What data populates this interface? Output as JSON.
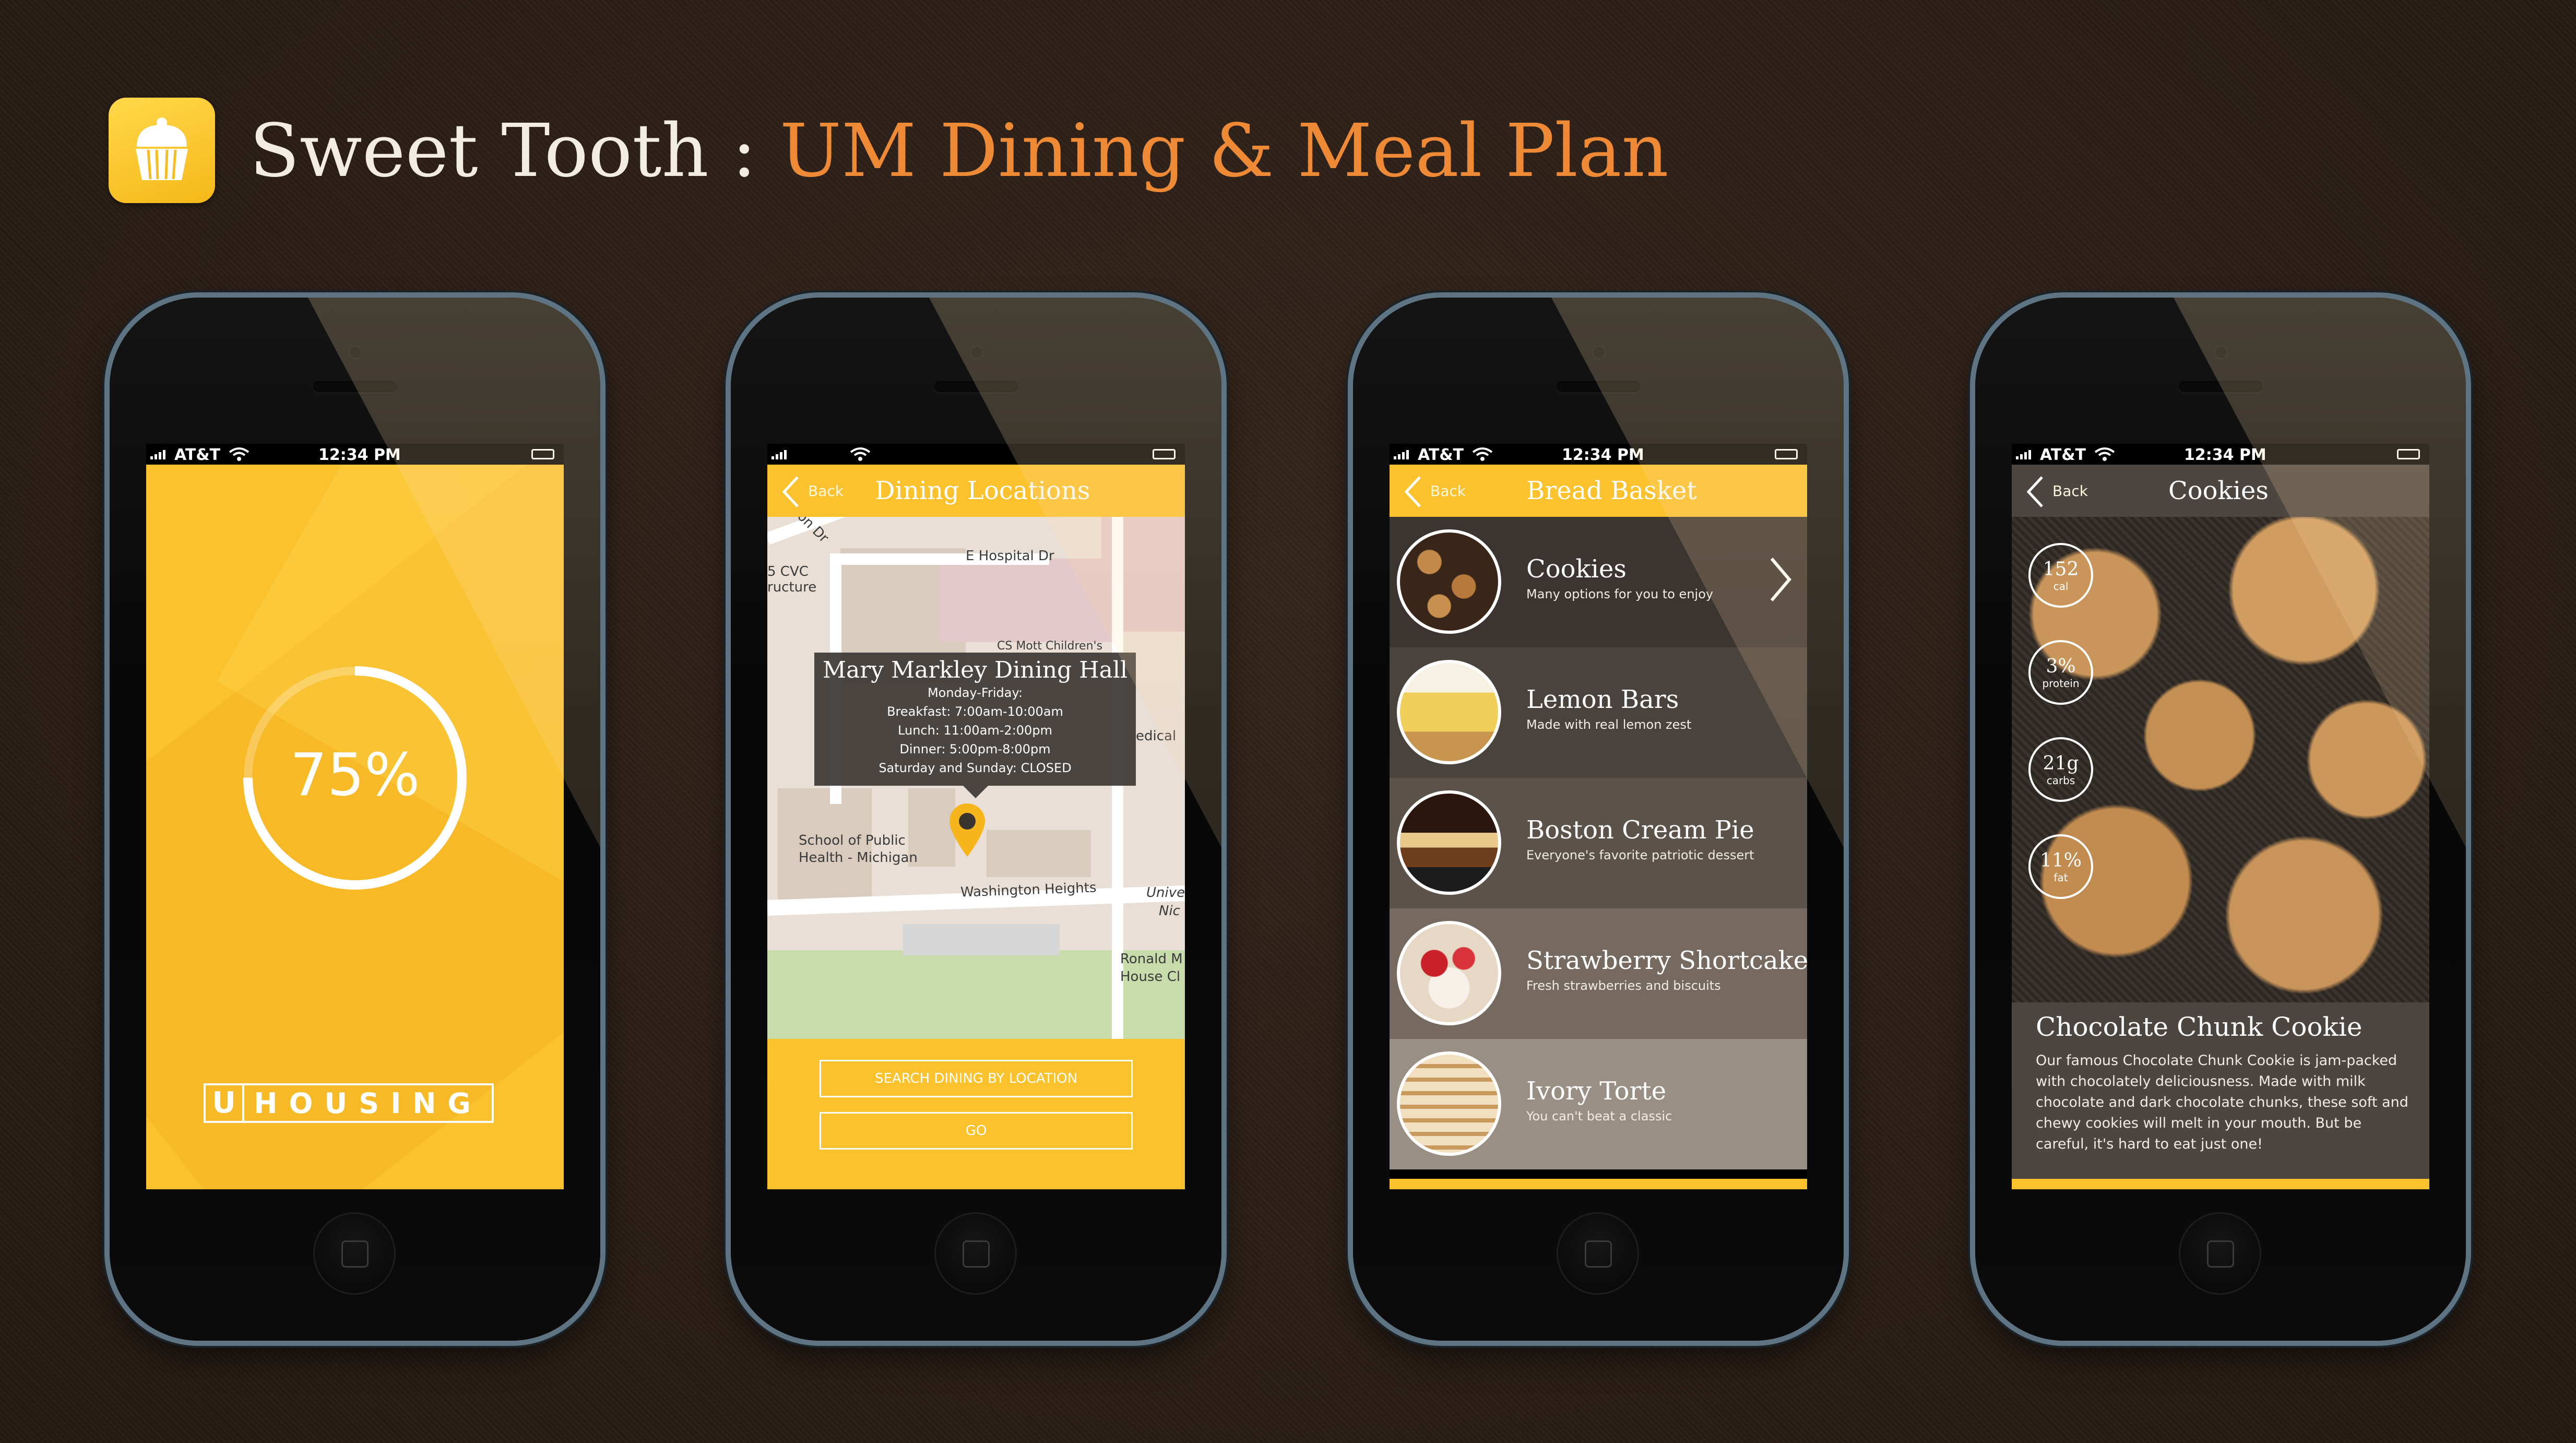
{
  "header": {
    "title_part1": "Sweet Tooth : ",
    "title_part2": "UM Dining & Meal Plan",
    "icon": "cupcake-icon",
    "accent_color": "#ee8a36"
  },
  "status": {
    "carrier": "AT&T",
    "time": "12:34 PM"
  },
  "screen1": {
    "progress_label": "75%",
    "progress_value": 0.75,
    "brand_letter": "U",
    "brand_word": "HOUSING"
  },
  "screen2": {
    "back_label": "Back",
    "title": "Dining Locations",
    "map_labels": [
      "E Hospital Dr",
      "5 CVC",
      "ructure",
      "CS Mott Children's",
      "edical",
      "School of Public",
      "Health - Michigan",
      "Washington Heights",
      "Unive",
      "Nic",
      "Ronald M",
      "House Cl",
      "son Dr"
    ],
    "popup": {
      "title": "Mary Markley Dining Hall",
      "lines": [
        "Monday-Friday:",
        "Breakfast: 7:00am-10:00am",
        "Lunch: 11:00am-2:00pm",
        "Dinner: 5:00pm-8:00pm",
        "Saturday and Sunday: CLOSED"
      ]
    },
    "search_placeholder": "SEARCH DINING BY LOCATION",
    "go_label": "GO"
  },
  "screen3": {
    "back_label": "Back",
    "title": "Bread Basket",
    "items": [
      {
        "name": "Cookies",
        "desc": "Many options for you to enjoy"
      },
      {
        "name": "Lemon Bars",
        "desc": "Made with real lemon zest"
      },
      {
        "name": "Boston Cream Pie",
        "desc": "Everyone's favorite patriotic dessert"
      },
      {
        "name": "Strawberry Shortcake",
        "desc": "Fresh strawberries and biscuits"
      },
      {
        "name": "Ivory Torte",
        "desc": "You can't beat a classic"
      }
    ]
  },
  "screen4": {
    "back_label": "Back",
    "title": "Cookies",
    "stats": [
      {
        "value": "152",
        "unit": "cal"
      },
      {
        "value": "3%",
        "unit": "protein"
      },
      {
        "value": "21g",
        "unit": "carbs"
      },
      {
        "value": "11%",
        "unit": "fat"
      }
    ],
    "item_title": "Chocolate Chunk Cookie",
    "item_desc": "Our famous Chocolate Chunk Cookie is jam-packed with chocolately deliciousness. Made with milk chocolate and dark chocolate chunks, these soft and chewy cookies will melt in your mouth. But be careful, it's hard to eat just one!"
  },
  "colors": {
    "yellow": "#fbc22e",
    "background": "#2b1f17",
    "orange_text": "#ee8a36"
  }
}
